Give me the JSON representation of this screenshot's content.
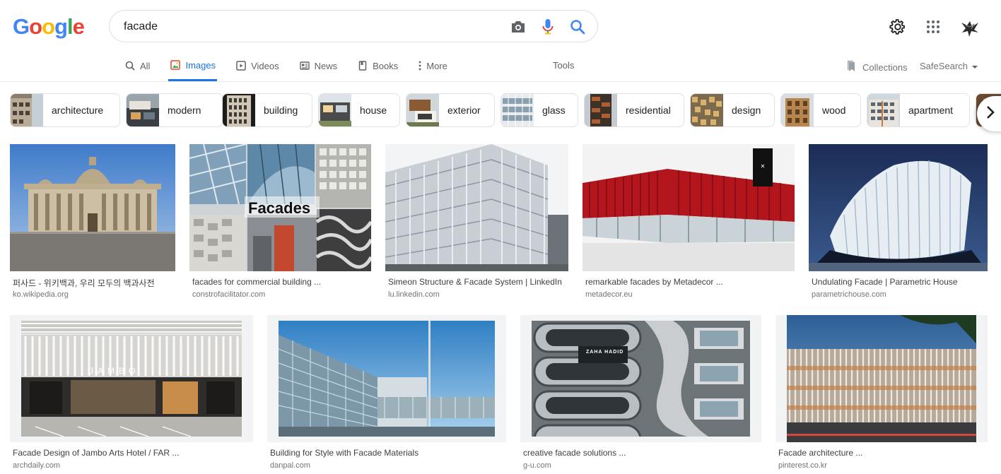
{
  "logo": {
    "letters": [
      "G",
      "o",
      "o",
      "g",
      "l",
      "e"
    ],
    "colors": [
      "#4285F4",
      "#EA4335",
      "#FBBC05",
      "#4285F4",
      "#34A853",
      "#EA4335"
    ]
  },
  "search": {
    "value": "facade"
  },
  "icons": {
    "camera": "camera-icon",
    "mic": "microphone-icon",
    "search": "search-icon",
    "settings": "gear-icon",
    "apps": "apps-grid-icon"
  },
  "tabs": [
    {
      "label": "All",
      "icon": "search-icon",
      "active": false
    },
    {
      "label": "Images",
      "icon": "image-icon",
      "active": true
    },
    {
      "label": "Videos",
      "icon": "video-icon",
      "active": false
    },
    {
      "label": "News",
      "icon": "news-icon",
      "active": false
    },
    {
      "label": "Books",
      "icon": "book-icon",
      "active": false
    },
    {
      "label": "More",
      "icon": "more-vertical-icon",
      "active": false
    }
  ],
  "tools_label": "Tools",
  "collections_label": "Collections",
  "safesearch_label": "SafeSearch",
  "chips": [
    {
      "label": "architecture"
    },
    {
      "label": "modern"
    },
    {
      "label": "building"
    },
    {
      "label": "house"
    },
    {
      "label": "exterior"
    },
    {
      "label": "glass"
    },
    {
      "label": "residential"
    },
    {
      "label": "design"
    },
    {
      "label": "wood"
    },
    {
      "label": "apartment"
    }
  ],
  "results": [
    {
      "caption": "퍼사드 - 위키백과, 우리 모두의 백과사전",
      "source": "ko.wikipedia.org"
    },
    {
      "caption": "facades for commercial building ...",
      "source": "constrofacilitator.com",
      "overlay": "Facades"
    },
    {
      "caption": "Simeon Structure & Facade System | LinkedIn",
      "source": "lu.linkedin.com"
    },
    {
      "caption": "remarkable facades by Metadecor ...",
      "source": "metadecor.eu"
    },
    {
      "caption": "Undulating Facade | Parametric House",
      "source": "parametrichouse.com"
    },
    {
      "caption": "Facade Design of Jambo Arts Hotel / FAR ...",
      "source": "archdaily.com",
      "overlay": "JAMBO"
    },
    {
      "caption": "Building for Style with Facade Materials",
      "source": "danpal.com"
    },
    {
      "caption": "creative facade solutions ...",
      "source": "g-u.com",
      "overlay": "ZAHA HADID"
    },
    {
      "caption": "Facade architecture ...",
      "source": "pinterest.co.kr"
    }
  ]
}
